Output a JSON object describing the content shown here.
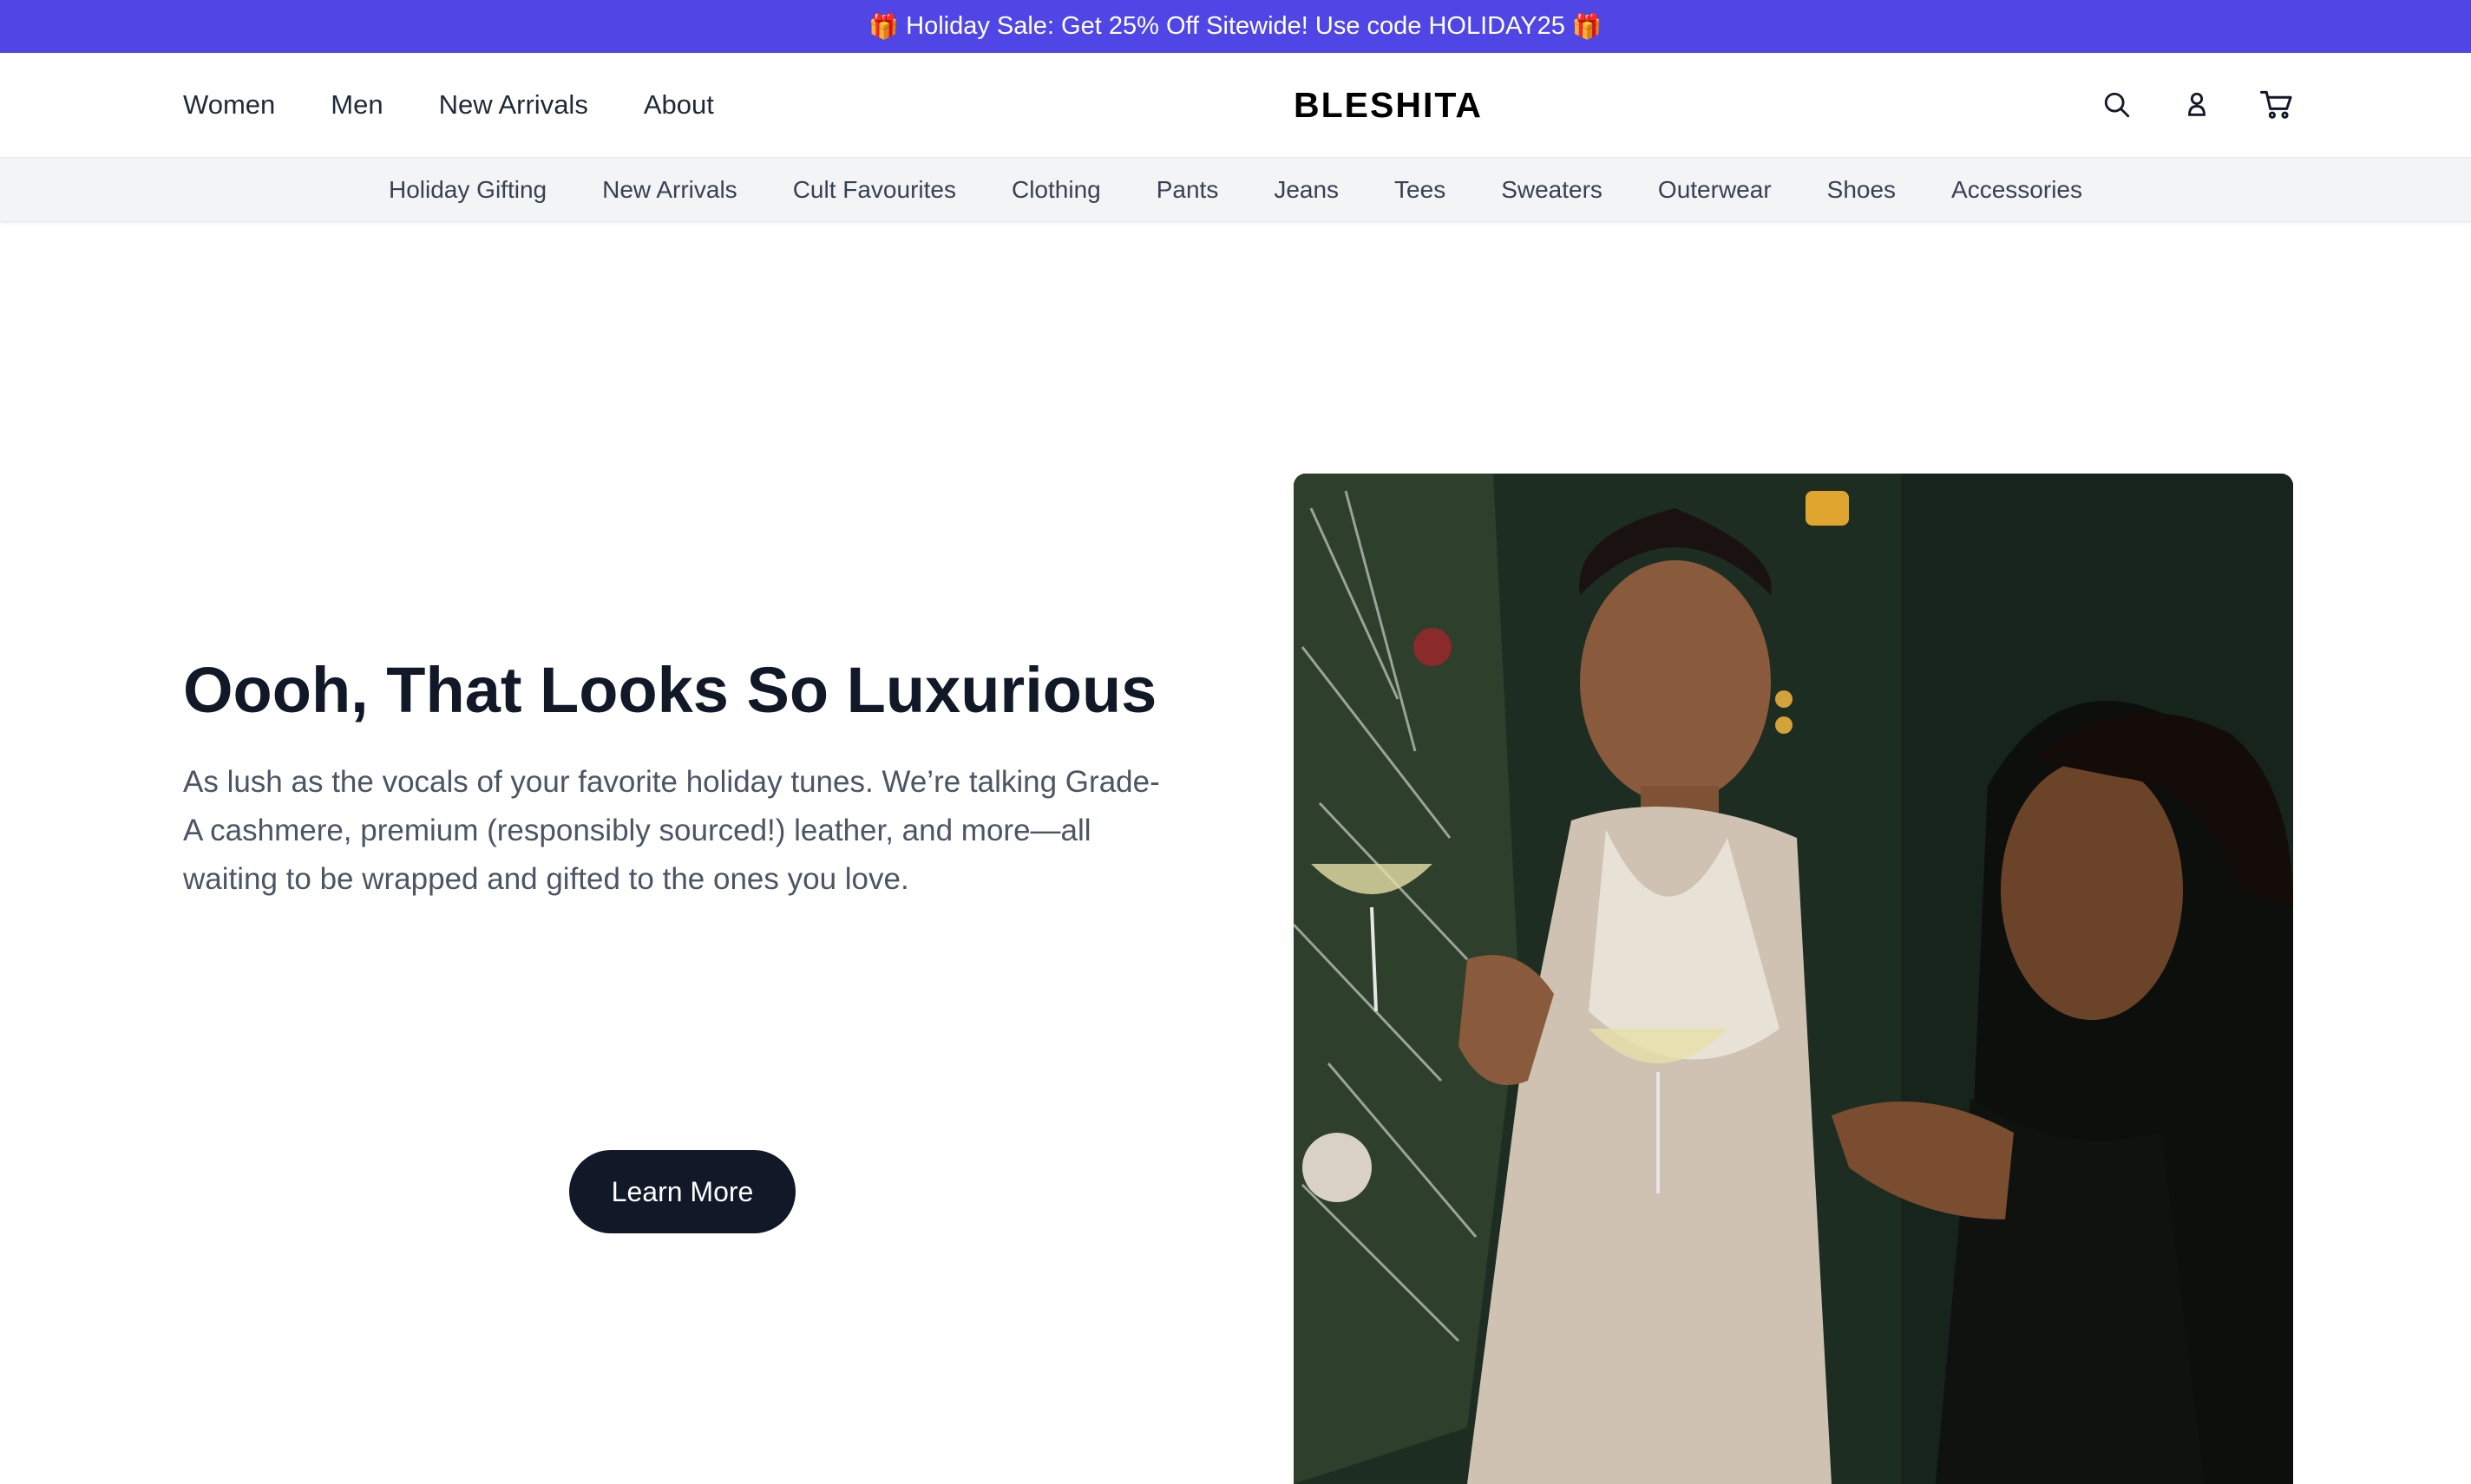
{
  "promo": {
    "text": "Holiday Sale: Get 25% Off Sitewide! Use code HOLIDAY25",
    "icon_left": "🎁",
    "icon_right": "🎁",
    "background": "#4f46e5"
  },
  "header": {
    "brand": "BLESHITA",
    "nav": [
      {
        "label": "Women"
      },
      {
        "label": "Men"
      },
      {
        "label": "New Arrivals"
      },
      {
        "label": "About"
      }
    ],
    "icons": [
      "search-icon",
      "account-icon",
      "cart-icon"
    ]
  },
  "categories": [
    "Holiday Gifting",
    "New Arrivals",
    "Cult Favourites",
    "Clothing",
    "Pants",
    "Jeans",
    "Tees",
    "Sweaters",
    "Outerwear",
    "Shoes",
    "Accessories"
  ],
  "hero": {
    "headline": "Oooh, That Looks So Luxurious",
    "body": "As lush as the vocals of your favorite holiday tunes. We’re talking Grade-A cashmere, premium (responsibly sourced!) leather, and more—all waiting to be wrapped and gifted to the ones you love.",
    "cta": "Learn More",
    "cta_color": "#111827"
  }
}
